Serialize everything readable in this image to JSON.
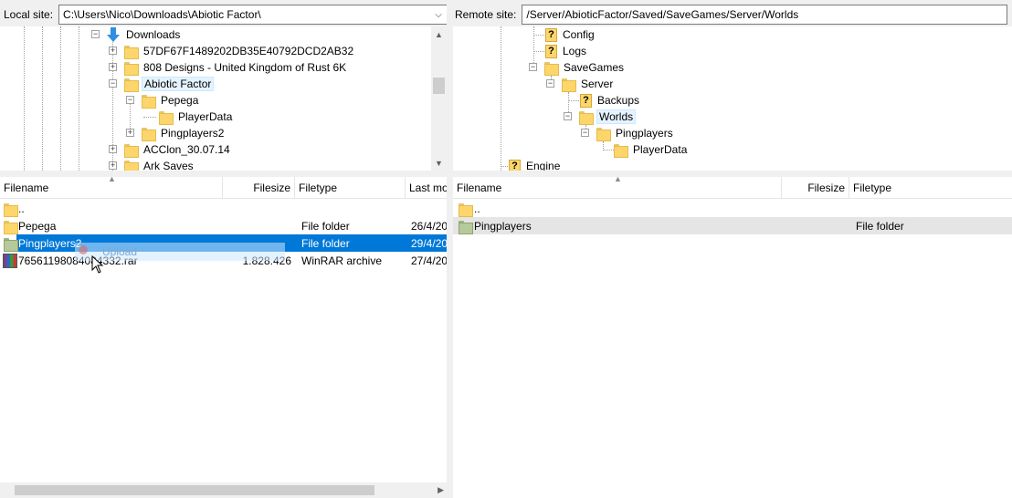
{
  "local": {
    "site_label": "Local site:",
    "path": "C:\\Users\\Nico\\Downloads\\Abiotic Factor\\",
    "tree": [
      {
        "label": "Downloads",
        "icon": "download-folder-icon",
        "expander": "minus"
      },
      {
        "label": "57DF67F1489202DB35E40792DCD2AB32",
        "icon": "folder-icon",
        "expander": "plus"
      },
      {
        "label": "808 Designs - United Kingdom of Rust 6K",
        "icon": "folder-icon",
        "expander": "plus"
      },
      {
        "label": "Abiotic Factor",
        "icon": "folder-icon",
        "expander": "minus",
        "selected": true
      },
      {
        "label": "Pepega",
        "icon": "folder-icon",
        "expander": "minus"
      },
      {
        "label": "PlayerData",
        "icon": "folder-icon",
        "expander": ""
      },
      {
        "label": "Pingplayers2",
        "icon": "folder-icon",
        "expander": "plus"
      },
      {
        "label": "ACClon_30.07.14",
        "icon": "folder-icon",
        "expander": "plus"
      },
      {
        "label": "Ark Saves",
        "icon": "folder-icon",
        "expander": "plus"
      }
    ],
    "columns": [
      "Filename",
      "Filesize",
      "Filetype",
      "Last mo"
    ],
    "files": [
      {
        "name": "..",
        "size": "",
        "type": "",
        "modified": "",
        "icon": "folder-icon"
      },
      {
        "name": "Pepega",
        "size": "",
        "type": "File folder",
        "modified": "26/4/20",
        "icon": "folder-icon"
      },
      {
        "name": "Pingplayers2",
        "size": "",
        "type": "File folder",
        "modified": "29/4/20",
        "icon": "folder-icon",
        "selected": true
      },
      {
        "name": "76561198084084332.rar",
        "size": "1.828.426",
        "type": "WinRAR archive",
        "modified": "27/4/20",
        "icon": "winrar-archive-icon"
      }
    ],
    "drag_hint": "Upload"
  },
  "remote": {
    "site_label": "Remote site:",
    "path": "/Server/AbioticFactor/Saved/SaveGames/Server/Worlds",
    "tree": [
      {
        "label": "Config",
        "icon": "unknown-folder-icon",
        "expander": ""
      },
      {
        "label": "Logs",
        "icon": "unknown-folder-icon",
        "expander": ""
      },
      {
        "label": "SaveGames",
        "icon": "folder-icon",
        "expander": "minus"
      },
      {
        "label": "Server",
        "icon": "folder-icon",
        "expander": "minus"
      },
      {
        "label": "Backups",
        "icon": "unknown-folder-icon",
        "expander": ""
      },
      {
        "label": "Worlds",
        "icon": "folder-icon",
        "expander": "minus",
        "selected": true
      },
      {
        "label": "Pingplayers",
        "icon": "folder-icon",
        "expander": "minus"
      },
      {
        "label": "PlayerData",
        "icon": "folder-icon",
        "expander": ""
      },
      {
        "label": "Engine",
        "icon": "unknown-folder-icon",
        "expander": ""
      }
    ],
    "columns": [
      "Filename",
      "Filesize",
      "Filetype"
    ],
    "files": [
      {
        "name": "..",
        "size": "",
        "type": "",
        "icon": "folder-icon"
      },
      {
        "name": "Pingplayers",
        "size": "",
        "type": "File folder",
        "icon": "folder-icon",
        "hover": true
      }
    ]
  }
}
